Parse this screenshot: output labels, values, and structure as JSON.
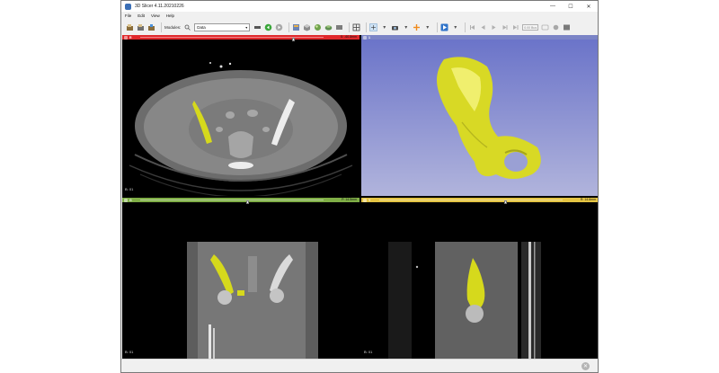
{
  "window": {
    "title": "3D Slicer 4.11.20210226",
    "controls": {
      "minimize": "—",
      "maximize": "☐",
      "close": "✕"
    }
  },
  "menu": [
    "File",
    "Edit",
    "View",
    "Help"
  ],
  "toolbar": {
    "modules_label": "Modules:",
    "module_selected": "Data",
    "time_display": "0.00 Bus",
    "icons": [
      "load-data-icon",
      "dicom-icon",
      "save-icon",
      "module-history-icon",
      "back-icon",
      "forward-icon",
      "welcome-icon",
      "volumes-icon",
      "models-icon",
      "transforms-icon",
      "markups-icon",
      "layout-icon",
      "crosshair-icon",
      "screenshot-icon",
      "placement-icon"
    ]
  },
  "views": {
    "axial": {
      "label": "R",
      "value": "S: -60.8mm",
      "corner": "B: 01",
      "bar_color": "#e0282c"
    },
    "three_d": {
      "label": "1",
      "bar_color": "#7b84c6",
      "background_top": "#6b74c9",
      "background_bottom": "#b1b4dc",
      "model_color": "#e4e61f"
    },
    "coronal": {
      "label": "G",
      "value": "P: 14.5mm",
      "corner": "B: 01",
      "bar_color": "#7fae46"
    },
    "sagittal": {
      "label": "Y",
      "value": "R: 14.6mm",
      "corner": "B: 01",
      "bar_color": "#e4c443"
    }
  },
  "colors": {
    "segment": "#d6d91c"
  }
}
